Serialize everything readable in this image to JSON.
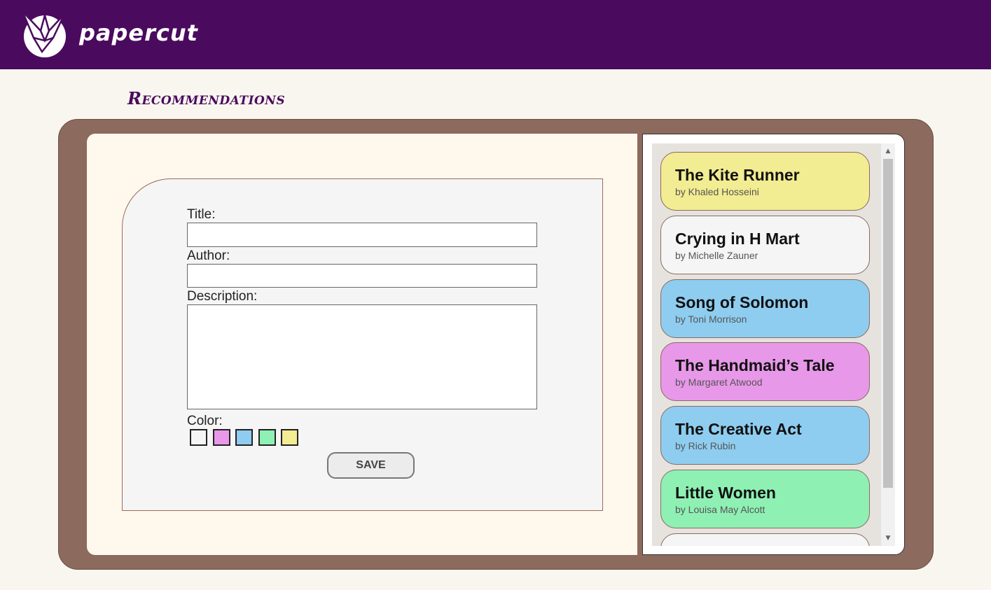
{
  "header": {
    "brand": "papercut",
    "logo_icon": "paper-crane-icon"
  },
  "page": {
    "heading": "Recommendations"
  },
  "form": {
    "title_label": "Title:",
    "title_value": "",
    "author_label": "Author:",
    "author_value": "",
    "description_label": "Description:",
    "description_value": "",
    "color_label": "Color:",
    "color_options": [
      "#f5f5f5",
      "#e898e8",
      "#8ecdf0",
      "#8ff0b4",
      "#f2ec92"
    ],
    "save_label": "SAVE"
  },
  "books": [
    {
      "title": "The Kite Runner",
      "author": "by Khaled Hosseini",
      "color": "#f2ec92"
    },
    {
      "title": "Crying in H Mart",
      "author": "by Michelle Zauner",
      "color": "#f5f5f5"
    },
    {
      "title": "Song of Solomon",
      "author": "by Toni Morrison",
      "color": "#8ecdf0"
    },
    {
      "title": "The Handmaid’s Tale",
      "author": "by Margaret Atwood",
      "color": "#e898e8"
    },
    {
      "title": "The Creative Act",
      "author": "by Rick Rubin",
      "color": "#8ecdf0"
    },
    {
      "title": "Little Women",
      "author": "by Louisa May Alcott",
      "color": "#8ff0b4"
    },
    {
      "title": "",
      "author": "",
      "color": "#f5f5f5"
    }
  ],
  "colors": {
    "header_bg": "#4a0b5e",
    "board": "#8c6a5d",
    "page_bg": "#f9f6f0"
  }
}
